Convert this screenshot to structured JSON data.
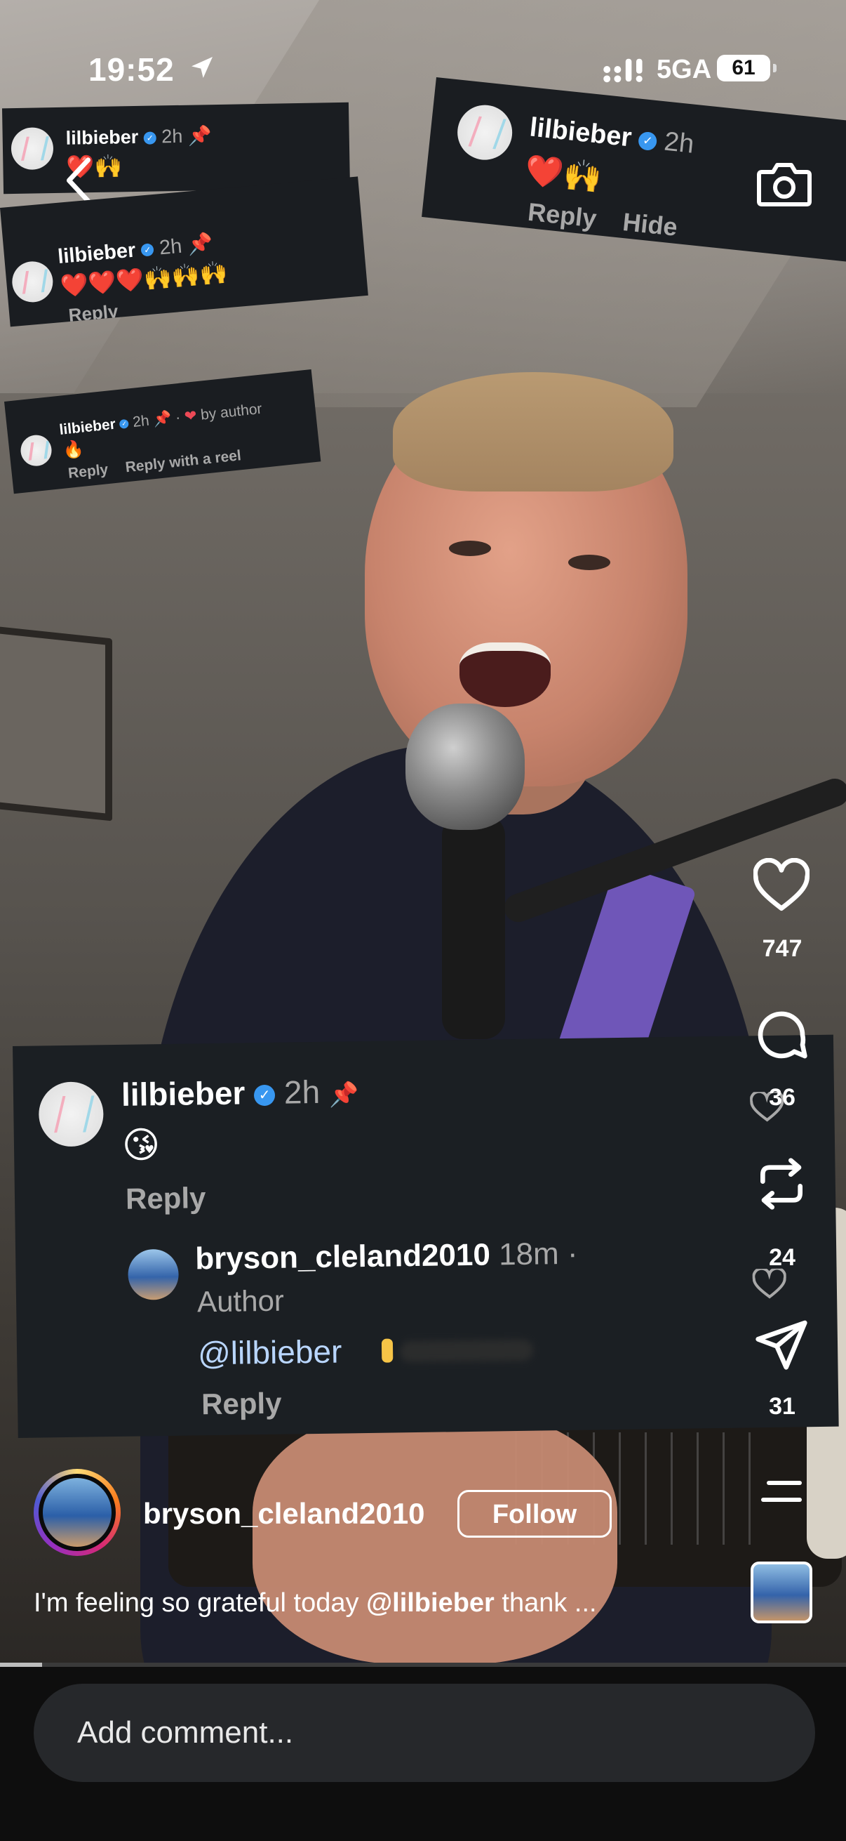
{
  "status_bar": {
    "time": "19:52",
    "network": "5GA",
    "battery": "61"
  },
  "overlay_comments": [
    {
      "username": "lilbieber",
      "time": "2h",
      "emojis": "❤️🙌"
    },
    {
      "username": "lilbieber",
      "time": "2h",
      "emojis": "❤️❤️❤️🙌🙌🙌",
      "reply": "Reply"
    },
    {
      "username": "lilbieber",
      "time": "2h",
      "liked": "by author",
      "emojis": "🔥",
      "reply": "Reply",
      "reply_reel": "Reply with a reel"
    },
    {
      "username": "lilbieber",
      "time": "2h",
      "emojis": "❤️🙌",
      "reply": "Reply",
      "hide": "Hide"
    }
  ],
  "main_comment": {
    "username": "lilbieber",
    "time": "2h",
    "emoji": "😘",
    "reply": "Reply",
    "nested": {
      "username": "bryson_cleland2010",
      "time": "18m ·",
      "role": "Author",
      "mention": "@lilbieber",
      "reply": "Reply"
    }
  },
  "actions": {
    "likes": "747",
    "comments": "36",
    "reposts": "24",
    "shares": "31"
  },
  "post": {
    "author": "bryson_cleland2010",
    "follow_label": "Follow",
    "caption_start": "I'm feeling so grateful today ",
    "caption_mention": "@lilbieber",
    "caption_end": " thank ..."
  },
  "progress": 0.05,
  "comment_bar": {
    "placeholder": "Add comment..."
  },
  "colors": {
    "verified": "#3897f0",
    "mention": "#b9d6ff",
    "card_bg": "#1b1f23"
  }
}
